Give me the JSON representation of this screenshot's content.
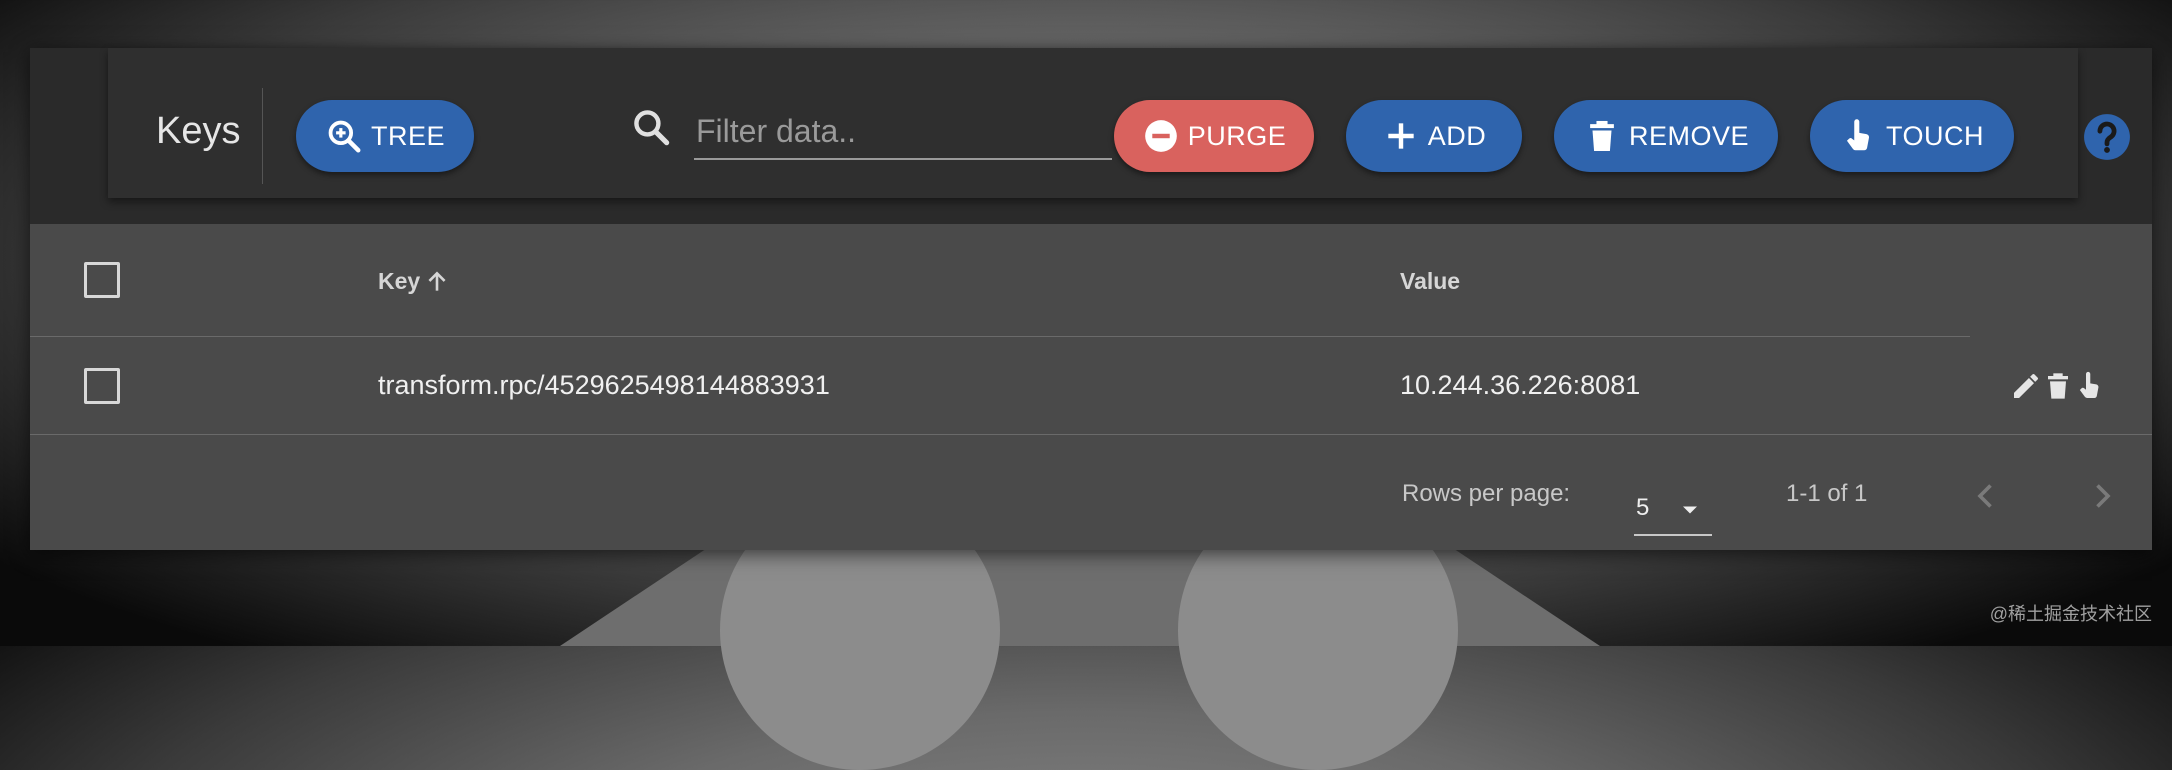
{
  "header": {
    "title": "Keys"
  },
  "toolbar": {
    "tree_label": "TREE",
    "search_placeholder": "Filter data..",
    "search_value": "",
    "purge_label": "PURGE",
    "add_label": "ADD",
    "remove_label": "REMOVE",
    "touch_label": "TOUCH"
  },
  "table": {
    "columns": {
      "key": "Key",
      "value": "Value"
    },
    "sort": {
      "column": "Key",
      "direction": "ascending"
    },
    "rows": [
      {
        "key": "transform.rpc/4529625498144883931",
        "value": "10.244.36.226:8081"
      }
    ]
  },
  "pagination": {
    "rows_per_page_label": "Rows per page:",
    "rows_per_page": "5",
    "range": "1-1 of 1"
  },
  "watermark": "@稀土掘金技术社区",
  "colors": {
    "primary_button": "#2f64ad",
    "danger_button": "#d9625e",
    "panel": "#2a2a2a",
    "table": "#4a4a4a"
  },
  "icons": [
    "zoom-in-icon",
    "search-icon",
    "minus-circle-icon",
    "plus-icon",
    "trash-icon",
    "touch-hand-icon",
    "help-circle-icon",
    "arrow-up-icon",
    "pencil-icon",
    "chevron-down-icon",
    "chevron-left-icon",
    "chevron-right-icon"
  ]
}
